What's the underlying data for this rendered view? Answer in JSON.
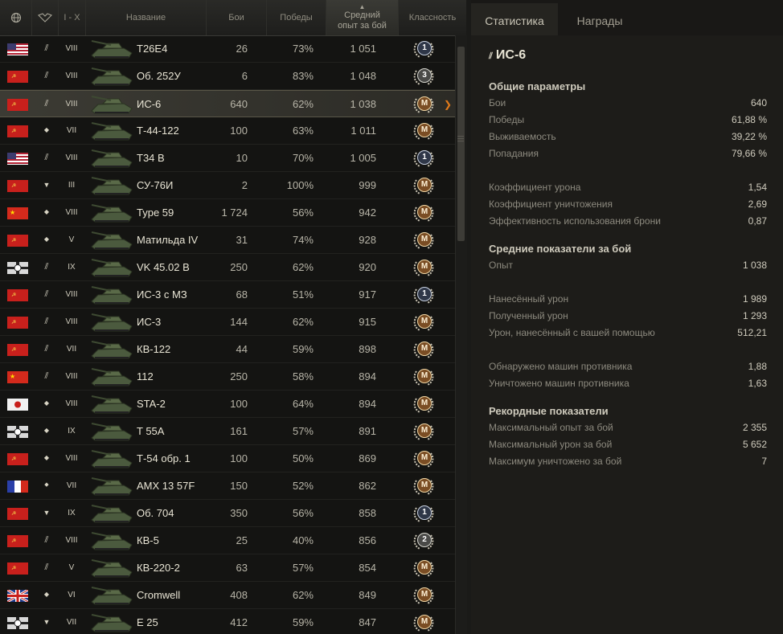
{
  "header": {
    "tier_range": "I - X",
    "name": "Название",
    "battles": "Бои",
    "wins": "Победы",
    "avg_xp_line1": "Средний",
    "avg_xp_line2": "опыт за бой",
    "mastery": "Классность"
  },
  "colors": {
    "selected_arrow": "#e07a1a"
  },
  "rows": [
    {
      "flag": "usa",
      "class": "heavy",
      "tier": "VIII",
      "name": "T26E4",
      "battles": "26",
      "wins": "73%",
      "xp": "1 051",
      "badge": "1"
    },
    {
      "flag": "ussr",
      "class": "heavy",
      "tier": "VIII",
      "name": "Об. 252У",
      "battles": "6",
      "wins": "83%",
      "xp": "1 048",
      "badge": "3"
    },
    {
      "flag": "ussr",
      "class": "heavy",
      "tier": "VIII",
      "name": "ИС-6",
      "battles": "640",
      "wins": "62%",
      "xp": "1 038",
      "badge": "M",
      "selected": true
    },
    {
      "flag": "ussr",
      "class": "medium",
      "tier": "VII",
      "name": "Т-44-122",
      "battles": "100",
      "wins": "63%",
      "xp": "1 011",
      "badge": "M"
    },
    {
      "flag": "usa",
      "class": "heavy",
      "tier": "VIII",
      "name": "T34 B",
      "battles": "10",
      "wins": "70%",
      "xp": "1 005",
      "badge": "1"
    },
    {
      "flag": "ussr",
      "class": "td",
      "tier": "III",
      "name": "СУ-76И",
      "battles": "2",
      "wins": "100%",
      "xp": "999",
      "badge": "M"
    },
    {
      "flag": "china",
      "class": "medium",
      "tier": "VIII",
      "name": "Type 59",
      "battles": "1 724",
      "wins": "56%",
      "xp": "942",
      "badge": "M"
    },
    {
      "flag": "ussr",
      "class": "medium",
      "tier": "V",
      "name": "Матильда IV",
      "battles": "31",
      "wins": "74%",
      "xp": "928",
      "badge": "M"
    },
    {
      "flag": "germany",
      "class": "heavy",
      "tier": "IX",
      "name": "VK 45.02 B",
      "battles": "250",
      "wins": "62%",
      "xp": "920",
      "badge": "M"
    },
    {
      "flag": "ussr",
      "class": "heavy",
      "tier": "VIII",
      "name": "ИС-3 с МЗ",
      "battles": "68",
      "wins": "51%",
      "xp": "917",
      "badge": "1"
    },
    {
      "flag": "ussr",
      "class": "heavy",
      "tier": "VIII",
      "name": "ИС-3",
      "battles": "144",
      "wins": "62%",
      "xp": "915",
      "badge": "M"
    },
    {
      "flag": "ussr",
      "class": "heavy",
      "tier": "VII",
      "name": "КВ-122",
      "battles": "44",
      "wins": "59%",
      "xp": "898",
      "badge": "M"
    },
    {
      "flag": "china",
      "class": "heavy",
      "tier": "VIII",
      "name": "112",
      "battles": "250",
      "wins": "58%",
      "xp": "894",
      "badge": "M"
    },
    {
      "flag": "japan",
      "class": "medium",
      "tier": "VIII",
      "name": "STA-2",
      "battles": "100",
      "wins": "64%",
      "xp": "894",
      "badge": "M"
    },
    {
      "flag": "germany",
      "class": "medium",
      "tier": "IX",
      "name": "T 55A",
      "battles": "161",
      "wins": "57%",
      "xp": "891",
      "badge": "M"
    },
    {
      "flag": "ussr",
      "class": "medium",
      "tier": "VIII",
      "name": "Т-54 обр. 1",
      "battles": "100",
      "wins": "50%",
      "xp": "869",
      "badge": "M"
    },
    {
      "flag": "france",
      "class": "light",
      "tier": "VII",
      "name": "AMX 13 57F",
      "battles": "150",
      "wins": "52%",
      "xp": "862",
      "badge": "M"
    },
    {
      "flag": "ussr",
      "class": "td",
      "tier": "IX",
      "name": "Об. 704",
      "battles": "350",
      "wins": "56%",
      "xp": "858",
      "badge": "1"
    },
    {
      "flag": "ussr",
      "class": "heavy",
      "tier": "VIII",
      "name": "КВ-5",
      "battles": "25",
      "wins": "40%",
      "xp": "856",
      "badge": "2"
    },
    {
      "flag": "ussr",
      "class": "heavy",
      "tier": "V",
      "name": "КВ-220-2",
      "battles": "63",
      "wins": "57%",
      "xp": "854",
      "badge": "M"
    },
    {
      "flag": "uk",
      "class": "medium",
      "tier": "VI",
      "name": "Cromwell",
      "battles": "408",
      "wins": "62%",
      "xp": "849",
      "badge": "M"
    },
    {
      "flag": "germany",
      "class": "td",
      "tier": "VII",
      "name": "E 25",
      "battles": "412",
      "wins": "59%",
      "xp": "847",
      "badge": "M"
    }
  ],
  "tabs": {
    "stats": "Статистика",
    "awards": "Награды"
  },
  "vehicle_title": "ИС-6",
  "sections": {
    "general": "Общие параметры",
    "average": "Средние показатели за бой",
    "records": "Рекордные показатели"
  },
  "stats": {
    "battles": {
      "label": "Бои",
      "value": "640"
    },
    "wins": {
      "label": "Победы",
      "value": "61,88 %"
    },
    "survival": {
      "label": "Выживаемость",
      "value": "39,22 %"
    },
    "hits": {
      "label": "Попадания",
      "value": "79,66 %"
    },
    "dmg_ratio": {
      "label": "Коэффициент урона",
      "value": "1,54"
    },
    "kill_ratio": {
      "label": "Коэффициент уничтожения",
      "value": "2,69"
    },
    "armor_eff": {
      "label": "Эффективность использования брони",
      "value": "0,87"
    },
    "avg_xp": {
      "label": "Опыт",
      "value": "1 038"
    },
    "dmg_dealt": {
      "label": "Нанесённый урон",
      "value": "1 989"
    },
    "dmg_recv": {
      "label": "Полученный урон",
      "value": "1 293"
    },
    "dmg_assist": {
      "label": "Урон, нанесённый с вашей помощью",
      "value": "512,21"
    },
    "spotted": {
      "label": "Обнаружено машин противника",
      "value": "1,88"
    },
    "destroyed": {
      "label": "Уничтожено машин противника",
      "value": "1,63"
    },
    "max_xp": {
      "label": "Максимальный опыт за бой",
      "value": "2 355"
    },
    "max_dmg": {
      "label": "Максимальный урон за бой",
      "value": "5 652"
    },
    "max_kills": {
      "label": "Максимум уничтожено за бой",
      "value": "7"
    }
  }
}
